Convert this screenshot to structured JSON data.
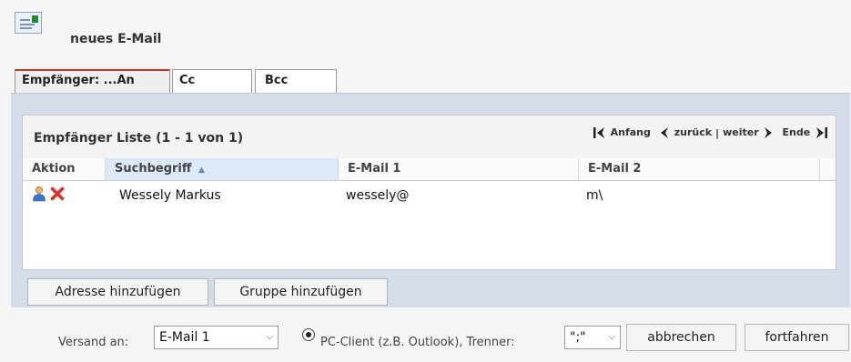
{
  "header": {
    "icon": "new-email-icon",
    "title": "neues E-Mail"
  },
  "tabs": [
    {
      "label": "Empfänger: ...An",
      "active": true
    },
    {
      "label": "Cc",
      "active": false
    },
    {
      "label": "Bcc",
      "active": false
    }
  ],
  "list": {
    "title": "Empfänger Liste (1 - 1 von 1)",
    "pager": {
      "first": "Anfang",
      "prev": "zurück",
      "separator": "|",
      "next": "weiter",
      "last": "Ende"
    },
    "columns": [
      "Aktion",
      "Suchbegriff",
      "E-Mail 1",
      "E-Mail 2"
    ],
    "sort_indicator": "▲",
    "rows": [
      {
        "actions": [
          "edit-contact-icon",
          "delete-icon"
        ],
        "suchbegriff": "Wessely Markus",
        "email1": "wessely@",
        "email2": "m\\"
      }
    ]
  },
  "buttons": {
    "add_address": "Adresse hinzufügen",
    "add_group": "Gruppe hinzufügen",
    "cancel": "abbrechen",
    "continue": "fortfahren"
  },
  "footer": {
    "send_to_label": "Versand an:",
    "send_to_value": "E-Mail 1",
    "radio_label": "PC-Client (z.B. Outlook), Trenner:",
    "separator_value": "\";\"",
    "chevron": "⌵"
  },
  "colors": {
    "panel": "#d3dce8",
    "active_tab_border": "#c0392b",
    "sorted_header": "#dbe9f8",
    "delete": "#e0302b"
  }
}
